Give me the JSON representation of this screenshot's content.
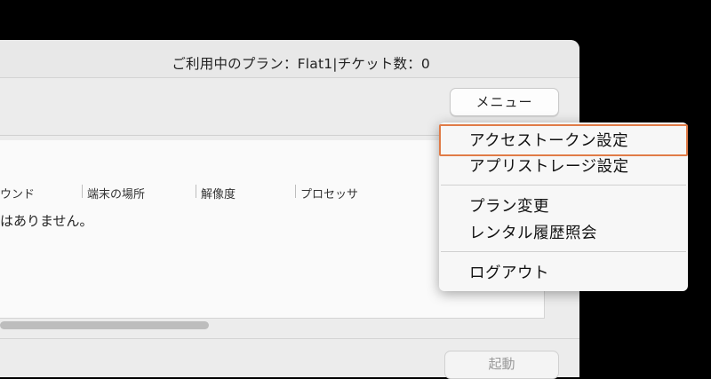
{
  "header": {
    "plan_info": "ご利用中のプラン：Flat1|チケット数：0",
    "menu_button_label": "メニュー"
  },
  "table": {
    "columns": [
      "ウンド",
      "端末の場所",
      "解像度",
      "プロセッサ"
    ],
    "empty_message": "はありません。"
  },
  "footer": {
    "launch_button_label": "起動"
  },
  "dropdown": {
    "items": [
      {
        "label": "アクセストークン設定",
        "highlighted": true
      },
      {
        "label": "アプリストレージ設定"
      },
      {
        "label": "プラン変更"
      },
      {
        "label": "レンタル履歴照会"
      },
      {
        "label": "ログアウト"
      }
    ]
  },
  "colors": {
    "highlight_border": "#e07b47",
    "window_bg": "#ececec",
    "desktop_bg": "#000000"
  }
}
